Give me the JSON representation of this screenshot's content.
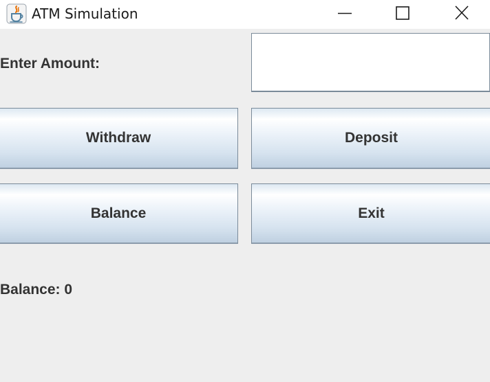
{
  "window": {
    "title": "ATM Simulation",
    "icon": "java-coffee-cup-icon",
    "controls": {
      "minimize": "minimize-icon",
      "maximize": "maximize-icon",
      "close": "close-icon"
    }
  },
  "form": {
    "amount_label": "Enter Amount:",
    "amount_value": ""
  },
  "buttons": {
    "withdraw": "Withdraw",
    "deposit": "Deposit",
    "balance": "Balance",
    "exit": "Exit"
  },
  "status": {
    "balance_text": "Balance: 0"
  },
  "colors": {
    "background": "#eeeeee",
    "titlebar": "#ffffff",
    "text": "#333333",
    "button_border": "#7a8a99",
    "button_gradient_bottom": "#bfd0e1"
  }
}
